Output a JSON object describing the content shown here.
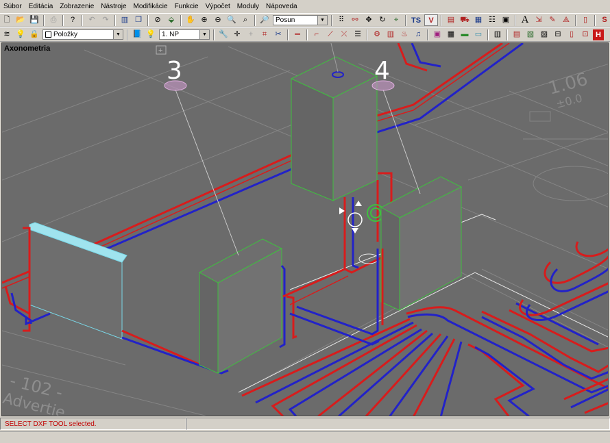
{
  "menu": [
    "Súbor",
    "Editácia",
    "Zobrazenie",
    "Nástroje",
    "Modifikácie",
    "Funkcie",
    "Výpočet",
    "Moduly",
    "Nápoveda"
  ],
  "toolbar1": {
    "mode_combo": "Posun",
    "ts_label": "TS",
    "v_label": "V"
  },
  "toolbar2": {
    "filter_combo": "Položky",
    "floor_combo": "1. NP",
    "h_label": "H"
  },
  "viewport": {
    "title": "Axonometria",
    "label_3": "3",
    "label_4": "4",
    "room_area": "1.06",
    "room_sub": "±0.0",
    "room_number": "- 102 -",
    "room_name": "Advertie"
  },
  "status": {
    "message": "SELECT DXF TOOL selected."
  },
  "colors": {
    "supply": "#d81c1c",
    "return": "#2222c8",
    "outline": "#3fbf3f",
    "background": "#6b6b6b"
  },
  "icons": {
    "toolbar1": [
      "new-file-icon",
      "open-folder-icon",
      "save-icon",
      "print-icon",
      "help-icon",
      "undo-icon",
      "redo-icon",
      "layout-icon",
      "window-icon",
      "measure-icon",
      "paint-icon",
      "pan-tool-icon",
      "zoom-in-icon",
      "zoom-out-icon",
      "zoom-window-icon",
      "zoom-extents-icon",
      "grid-icon",
      "link-icon",
      "move-icon",
      "refresh-icon",
      "snap-icon",
      "settings-icon",
      "calc-icon",
      "drawing-icon",
      "table-icon",
      "report-icon",
      "text-icon",
      "dimension-icon",
      "note-icon",
      "s-icon"
    ],
    "toolbar2": [
      "layers-icon",
      "bulb-icon",
      "lock-icon",
      "book-icon",
      "bulb-icon",
      "wrench-icon",
      "crosshair-icon",
      "plus-icon",
      "rect-icon",
      "cut-icon",
      "line-icon",
      "pipe-icon",
      "pipe-bend-icon",
      "pipe-cross-icon",
      "list-icon",
      "valve-icon",
      "radiator-icon",
      "heater-icon",
      "floor-heat-icon",
      "manifold-icon",
      "block-icon",
      "sum-icon",
      "wall-icon",
      "door-icon",
      "window-icon",
      "stairs-icon",
      "floor-icon",
      "grid-icon"
    ]
  }
}
